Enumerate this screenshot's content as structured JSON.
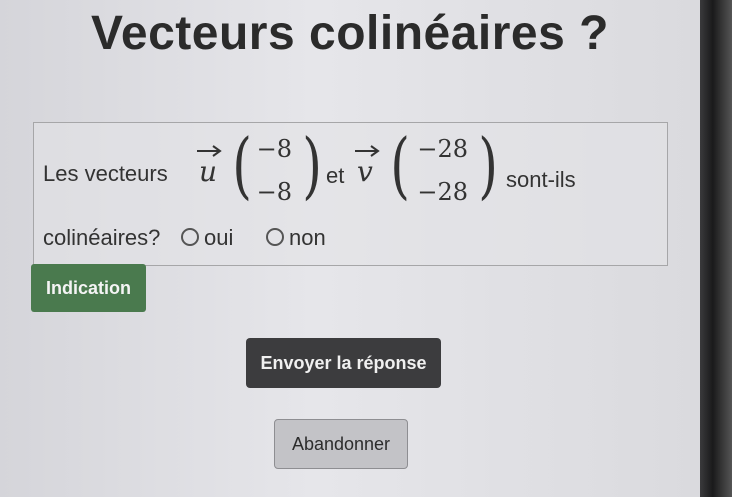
{
  "title": "Vecteurs colinéaires ?",
  "question": {
    "prefix": "Les vecteurs",
    "vector_u": {
      "name": "u",
      "components": [
        "−8",
        "−8"
      ]
    },
    "connector": "et",
    "vector_v": {
      "name": "v",
      "components": [
        "−28",
        "−28"
      ]
    },
    "suffix": "sont-ils",
    "line2": "colinéaires?",
    "options": [
      {
        "label": "oui",
        "selected": false
      },
      {
        "label": "non",
        "selected": false
      }
    ]
  },
  "buttons": {
    "hint": "Indication",
    "submit": "Envoyer la réponse",
    "abandon": "Abandonner"
  },
  "colors": {
    "hint_button": "#4a7a4e",
    "submit_button": "#3c3c3e",
    "abandon_button": "#c3c3c7"
  }
}
